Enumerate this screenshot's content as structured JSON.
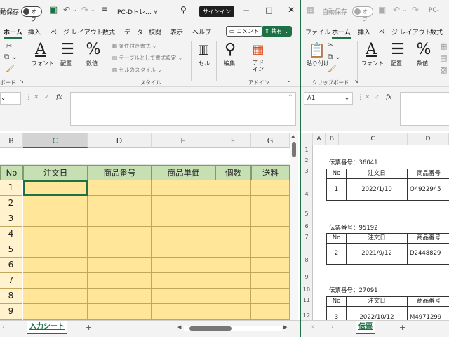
{
  "left_window": {
    "titlebar": {
      "autosave_label": "動保存",
      "autosave_state": "オフ",
      "doc_title": "PC-Dトレ… ∨",
      "signin_label": "サインイン"
    },
    "menu": [
      "ホーム",
      "挿入",
      "ページ レイアウト",
      "数式",
      "データ",
      "校閲",
      "表示",
      "ヘルプ"
    ],
    "comment_label": "コメント",
    "share_label": "共有",
    "ribbon": {
      "clipboard_group_label": "ボード",
      "font_label": "フォント",
      "align_label": "配置",
      "number_label": "数値",
      "cond_format_label": "条件付き書式",
      "table_format_label": "テーブルとして書式設定",
      "cell_style_label": "セルのスタイル",
      "style_group_label": "スタイル",
      "cells_label": "セル",
      "edit_label": "編集",
      "addin_label": "アド\nイン",
      "addin_group_label": "アドイン"
    },
    "formula": {
      "name_box": "",
      "fx_symbol": "fx"
    },
    "columns": [
      "B",
      "C",
      "D",
      "E",
      "F",
      "G"
    ],
    "table_headers": [
      "No",
      "注文日",
      "商品番号",
      "商品単価",
      "個数",
      "送料"
    ],
    "row_numbers": [
      "1",
      "2",
      "3",
      "4",
      "5",
      "6",
      "7",
      "8",
      "9"
    ],
    "sheet_tab": "入力シート",
    "add_sheet": "+"
  },
  "right_window": {
    "titlebar": {
      "autosave_label": "自動保存",
      "autosave_state": "オフ",
      "doc_title": "PC-"
    },
    "menu": [
      "ファイル",
      "ホーム",
      "挿入",
      "ページ レイアウト",
      "数式"
    ],
    "ribbon": {
      "paste_label": "貼り付け",
      "font_label": "フォント",
      "align_label": "配置",
      "number_label": "数値",
      "clipboard_group_label": "クリップボード"
    },
    "formula": {
      "name_box": "A1",
      "fx_symbol": "fx"
    },
    "columns": [
      "A",
      "B",
      "C",
      "D"
    ],
    "row_numbers": [
      "1",
      "2",
      "3",
      "4",
      "5",
      "6",
      "7",
      "8",
      "9",
      "10",
      "11",
      "12"
    ],
    "slip_header": [
      "No",
      "注文日",
      "商品番号"
    ],
    "slips": [
      {
        "title": "伝票番号：36041",
        "no": "1",
        "date": "2022/1/10",
        "product": "O4922945"
      },
      {
        "title": "伝票番号：95192",
        "no": "2",
        "date": "2021/9/12",
        "product": "D2448829"
      },
      {
        "title": "伝票番号：27091",
        "no": "3",
        "date": "2022/10/12",
        "product": "M4971299"
      }
    ],
    "sheet_tab": "伝票",
    "add_sheet": "+"
  },
  "colors": {
    "excel_green": "#1e7145",
    "header_green": "#c6e0b4",
    "cell_yellow": "#ffe699",
    "rownum_yellow": "#fff2cc"
  }
}
